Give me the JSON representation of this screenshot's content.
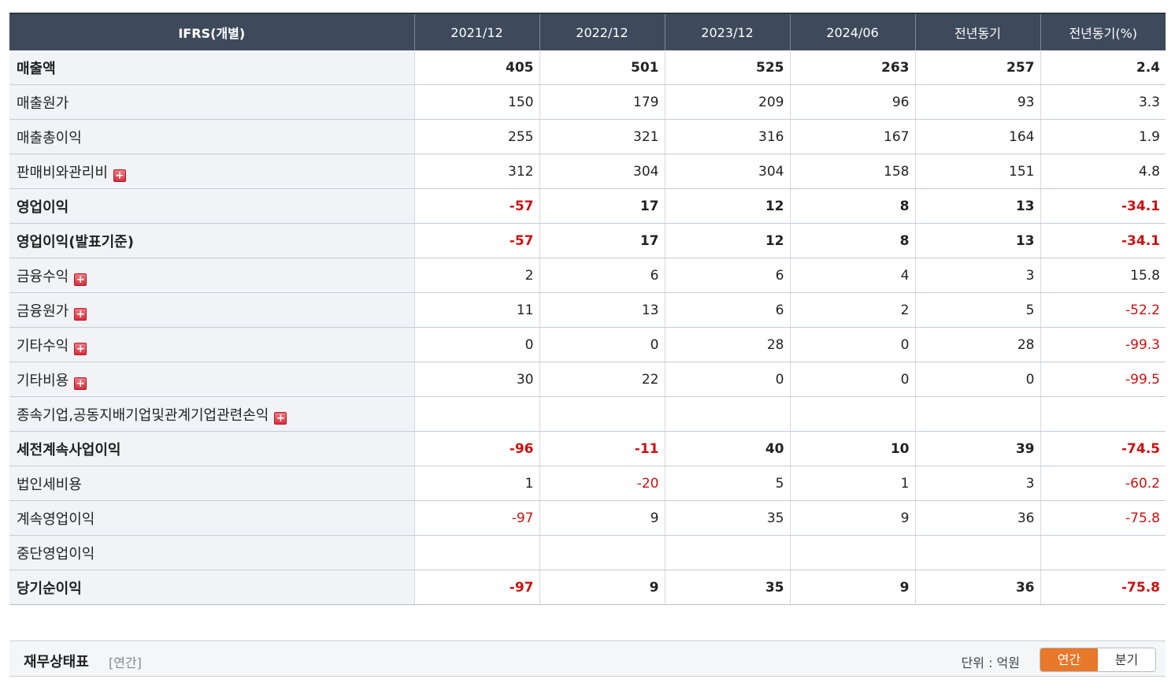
{
  "table": {
    "headers": [
      "IFRS(개별)",
      "2021/12",
      "2022/12",
      "2023/12",
      "2024/06",
      "전년동기",
      "전년동기(%)"
    ],
    "rows": [
      {
        "label": "매출액",
        "bold": true,
        "expand": false,
        "values": [
          "405",
          "501",
          "525",
          "263",
          "257",
          "2.4"
        ]
      },
      {
        "label": "매출원가",
        "bold": false,
        "expand": false,
        "values": [
          "150",
          "179",
          "209",
          "96",
          "93",
          "3.3"
        ]
      },
      {
        "label": "매출총이익",
        "bold": false,
        "expand": false,
        "values": [
          "255",
          "321",
          "316",
          "167",
          "164",
          "1.9"
        ]
      },
      {
        "label": "판매비와관리비",
        "bold": false,
        "expand": true,
        "values": [
          "312",
          "304",
          "304",
          "158",
          "151",
          "4.8"
        ]
      },
      {
        "label": "영업이익",
        "bold": true,
        "expand": false,
        "values": [
          "-57",
          "17",
          "12",
          "8",
          "13",
          "-34.1"
        ]
      },
      {
        "label": "영업이익(발표기준)",
        "bold": true,
        "expand": false,
        "values": [
          "-57",
          "17",
          "12",
          "8",
          "13",
          "-34.1"
        ]
      },
      {
        "label": "금융수익",
        "bold": false,
        "expand": true,
        "values": [
          "2",
          "6",
          "6",
          "4",
          "3",
          "15.8"
        ]
      },
      {
        "label": "금융원가",
        "bold": false,
        "expand": true,
        "values": [
          "11",
          "13",
          "6",
          "2",
          "5",
          "-52.2"
        ]
      },
      {
        "label": "기타수익",
        "bold": false,
        "expand": true,
        "values": [
          "0",
          "0",
          "28",
          "0",
          "28",
          "-99.3"
        ]
      },
      {
        "label": "기타비용",
        "bold": false,
        "expand": true,
        "values": [
          "30",
          "22",
          "0",
          "0",
          "0",
          "-99.5"
        ]
      },
      {
        "label": "종속기업,공동지배기업및관계기업관련손익",
        "bold": false,
        "expand": true,
        "values": [
          "",
          "",
          "",
          "",
          "",
          ""
        ]
      },
      {
        "label": "세전계속사업이익",
        "bold": true,
        "expand": false,
        "values": [
          "-96",
          "-11",
          "40",
          "10",
          "39",
          "-74.5"
        ]
      },
      {
        "label": "법인세비용",
        "bold": false,
        "expand": false,
        "values": [
          "1",
          "-20",
          "5",
          "1",
          "3",
          "-60.2"
        ]
      },
      {
        "label": "계속영업이익",
        "bold": false,
        "expand": false,
        "values": [
          "-97",
          "9",
          "35",
          "9",
          "36",
          "-75.8"
        ]
      },
      {
        "label": "중단영업이익",
        "bold": false,
        "expand": false,
        "values": [
          "",
          "",
          "",
          "",
          "",
          ""
        ]
      },
      {
        "label": "당기순이익",
        "bold": true,
        "expand": false,
        "values": [
          "-97",
          "9",
          "35",
          "9",
          "36",
          "-75.8"
        ]
      }
    ]
  },
  "icons": {
    "expand": "plus-icon",
    "expand_glyph": "+"
  },
  "section": {
    "title": "재무상태표",
    "subtitle": "[연간]",
    "unit": "단위 : 억원",
    "toggle": {
      "annual": "연간",
      "quarterly": "분기",
      "active": "annual"
    }
  },
  "colors": {
    "header_bg": "#3e4a5c",
    "negative": "#cc1111",
    "label_bg": "#f1f3f6",
    "toggle_active": "#e8782a"
  }
}
